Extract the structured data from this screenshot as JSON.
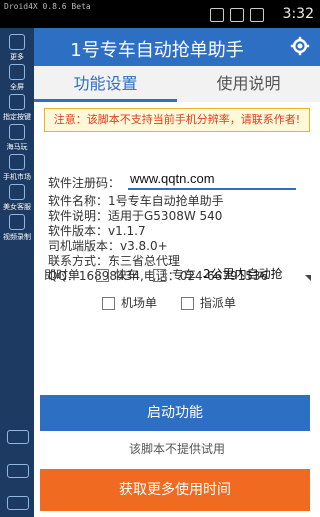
{
  "statusbar": {
    "left_text": "Droid4X 0.8.6 Beta",
    "time": "3:32"
  },
  "sidebar": {
    "items": [
      {
        "label": "更多",
        "icon": "more-icon"
      },
      {
        "label": "全屏",
        "icon": "fullscreen-icon"
      },
      {
        "label": "指定按键",
        "icon": "key-icon"
      },
      {
        "label": "海马玩",
        "icon": "haima-icon"
      },
      {
        "label": "手机市场",
        "icon": "market-icon"
      },
      {
        "label": "美女客服",
        "icon": "service-icon"
      },
      {
        "label": "视频录制",
        "icon": "record-icon"
      }
    ]
  },
  "app": {
    "title": "1号专车自动抢单助手",
    "tabs": [
      "功能设置",
      "使用说明"
    ],
    "notice": "注意：该脚本不支持当前手机分辨率，请联系作者!",
    "register": {
      "label": "软件注册码：",
      "value": "www.qqtn.com"
    },
    "info_lines": [
      "软件名称：1号专车自动抢单助手",
      "软件说明：适用于G5308W 540",
      "软件版本：v1.1.7",
      "司机端版本：v3.8.0+",
      "联系方式：东三省总代理",
      "QQ：16898434,电话：024-66791536"
    ],
    "options": {
      "instant_label": "即时单",
      "fast_label": "快车",
      "special_label": "专车",
      "dropdown_value": "2公里内自动抢",
      "airport_label": "机场单",
      "assign_label": "指派单"
    },
    "start_button": "启动功能",
    "trial_text": "该脚本不提供试用",
    "more_button": "获取更多使用时间"
  },
  "colors": {
    "primary": "#2d6fc3",
    "accent": "#f06a21",
    "notice_text": "#e33c1c"
  }
}
